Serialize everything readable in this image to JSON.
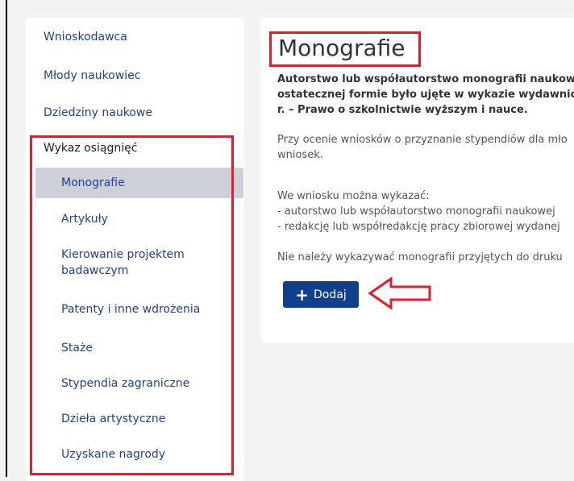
{
  "sidebar": {
    "top_items": [
      {
        "label": "Wnioskodawca"
      },
      {
        "label": "Młody naukowiec"
      },
      {
        "label": "Dziedziny naukowe"
      }
    ],
    "section_label": "Wykaz osiągnięć",
    "sub_items": [
      {
        "label": "Monografie",
        "active": true
      },
      {
        "label": "Artykuły"
      },
      {
        "label": "Kierowanie projektem badawczym"
      },
      {
        "label": "Patenty i inne wdrożenia"
      },
      {
        "label": "Staże"
      },
      {
        "label": "Stypendia zagraniczne"
      },
      {
        "label": "Dzieła artystyczne"
      },
      {
        "label": "Uzyskane nagrody"
      }
    ]
  },
  "main": {
    "title": "Monografie",
    "bold_text": [
      "Autorstwo lub współautorstwo monografii naukowej",
      "ostatecznej formie było ujęte w wykazie wydawnictw",
      "r. – Prawo o szkolnictwie wyższym i nauce."
    ],
    "para1": [
      "Przy ocenie wniosków o przyznanie stypendiów dla mło",
      "wniosek."
    ],
    "para2": [
      "We wniosku można wykazać:",
      "- autorstwo lub współautorstwo monografii naukowej",
      "- redakcję lub współredakcję pracy zbiorowej wydanej"
    ],
    "para3": "Nie należy wykazywać monografii przyjętych do druku",
    "add_button_label": "Dodaj"
  },
  "colors": {
    "link": "#1f3f9a",
    "highlight": "#e01e2e",
    "button": "#11408a",
    "active_bg": "#cdd0d6"
  }
}
